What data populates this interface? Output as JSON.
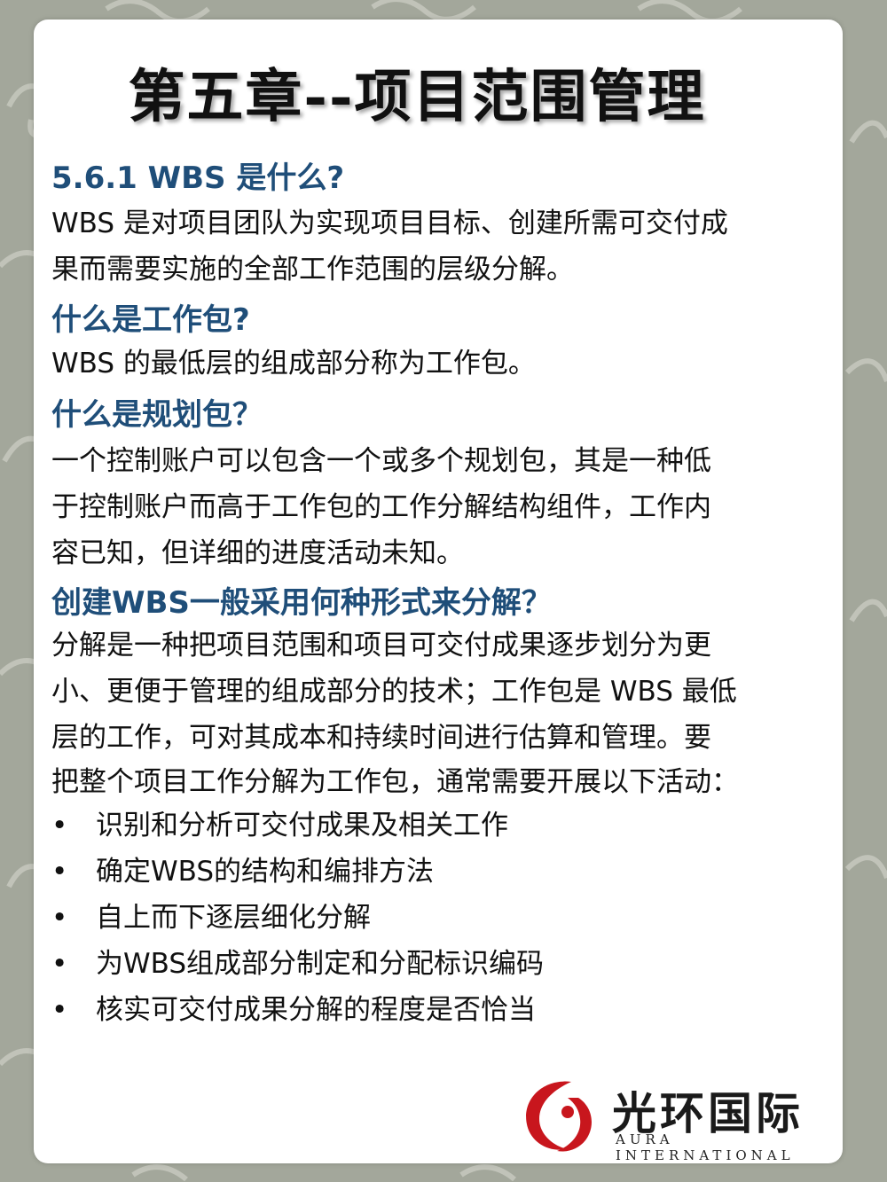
{
  "title": "第五章--项目范围管理",
  "sections": {
    "s1_heading": "5.6.1  WBS 是什么?",
    "s1_body_1": "WBS 是对项目团队为实现项目目标、创建所需可交付成",
    "s1_body_2": "果而需要实施的全部工作范围的层级分解。",
    "s2_heading": "什么是工作包?",
    "s2_body": "WBS 的最低层的组成部分称为工作包。",
    "s3_heading": "什么是规划包？",
    "s3_body_1": "一个控制账户可以包含一个或多个规划包，其是一种低",
    "s3_body_2": "于控制账户而高于工作包的工作分解结构组件，工作内",
    "s3_body_3": "容已知，但详细的进度活动未知。",
    "s4_heading": "创建WBS一般采用何种形式来分解？",
    "s4_body_1": "分解是一种把项目范围和项目可交付成果逐步划分为更",
    "s4_body_2": "小、更便于管理的组成部分的技术；工作包是 WBS 最低",
    "s4_body_3": "层的工作，可对其成本和持续时间进行估算和管理。要",
    "s4_body_4": "把整个项目工作分解为工作包，通常需要开展以下活动："
  },
  "bullet_char": "•",
  "bullets": [
    "识别和分析可交付成果及相关工作",
    "确定WBS的结构和编排方法",
    "自上而下逐层细化分解",
    "为WBS组成部分制定和分配标识编码",
    "核实可交付成果分解的程度是否恰当"
  ],
  "logo": {
    "name_cn": "光环国际",
    "name_en": "AURA INTERNATIONAL"
  },
  "colors": {
    "heading": "#1f4e79",
    "background": "#a3a79b",
    "logo_red": "#c8161d"
  }
}
